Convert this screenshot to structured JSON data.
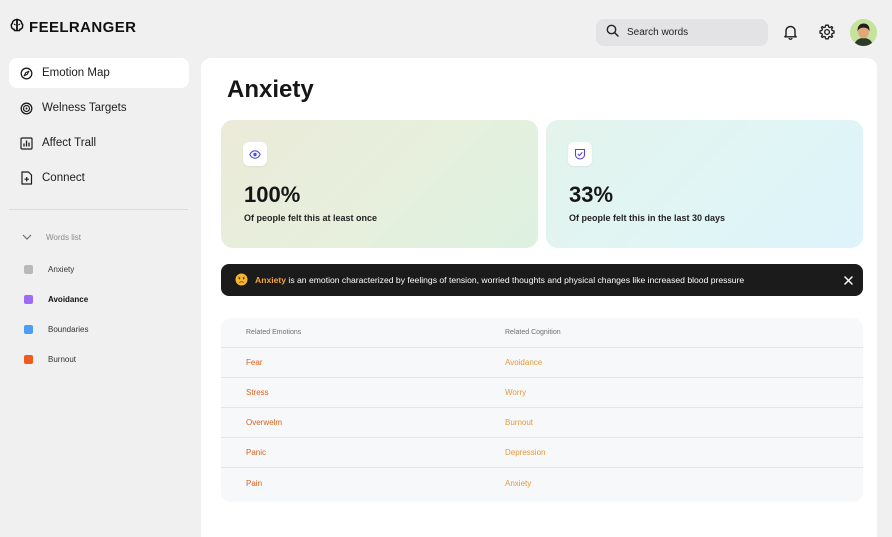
{
  "brand": {
    "name": "FEELRANGER"
  },
  "header": {
    "search_placeholder": "Search words",
    "icons": [
      "search-icon",
      "bell-icon",
      "gear-icon",
      "avatar"
    ]
  },
  "sidebar": {
    "items": [
      {
        "label": "Emotion Map",
        "icon": "compass-icon",
        "active": true
      },
      {
        "label": "Welness Targets",
        "icon": "target-icon",
        "active": false
      },
      {
        "label": "Affect Trall",
        "icon": "chart-icon",
        "active": false
      },
      {
        "label": "Connect",
        "icon": "document-icon",
        "active": false
      }
    ],
    "words_header": "Words list",
    "words": [
      {
        "label": "Anxiety",
        "color": "#b9b9bc",
        "active": false
      },
      {
        "label": "Avoidance",
        "color": "#9d6cf2",
        "active": true
      },
      {
        "label": "Boundaries",
        "color": "#4d9cf6",
        "active": false
      },
      {
        "label": "Burnout",
        "color": "#ef5a1f",
        "active": false
      }
    ]
  },
  "main": {
    "title": "Anxiety",
    "cards": [
      {
        "value": "100%",
        "label": "Of people felt this at least once",
        "icon": "eye-icon"
      },
      {
        "value": "33%",
        "label": "Of people felt this in the last 30 days",
        "icon": "shield-check-icon"
      }
    ],
    "banner": {
      "highlight": "Anxiety",
      "text": " is an emotion characterized by feelings of tension, worried thoughts and physical changes like increased blood pressure"
    },
    "table": {
      "headers": [
        "Related Emotions",
        "Related Cognition"
      ],
      "rows": [
        [
          "Fear",
          "Avoidance"
        ],
        [
          "Stress",
          "Worry"
        ],
        [
          "Overwelm",
          "Burnout"
        ],
        [
          "Panic",
          "Depression"
        ],
        [
          "Pain",
          "Anxiety"
        ]
      ]
    }
  },
  "colors": {
    "emotion_text": "#d9621e",
    "cognition_text": "#e19a3c",
    "banner_highlight": "#f4a340"
  }
}
